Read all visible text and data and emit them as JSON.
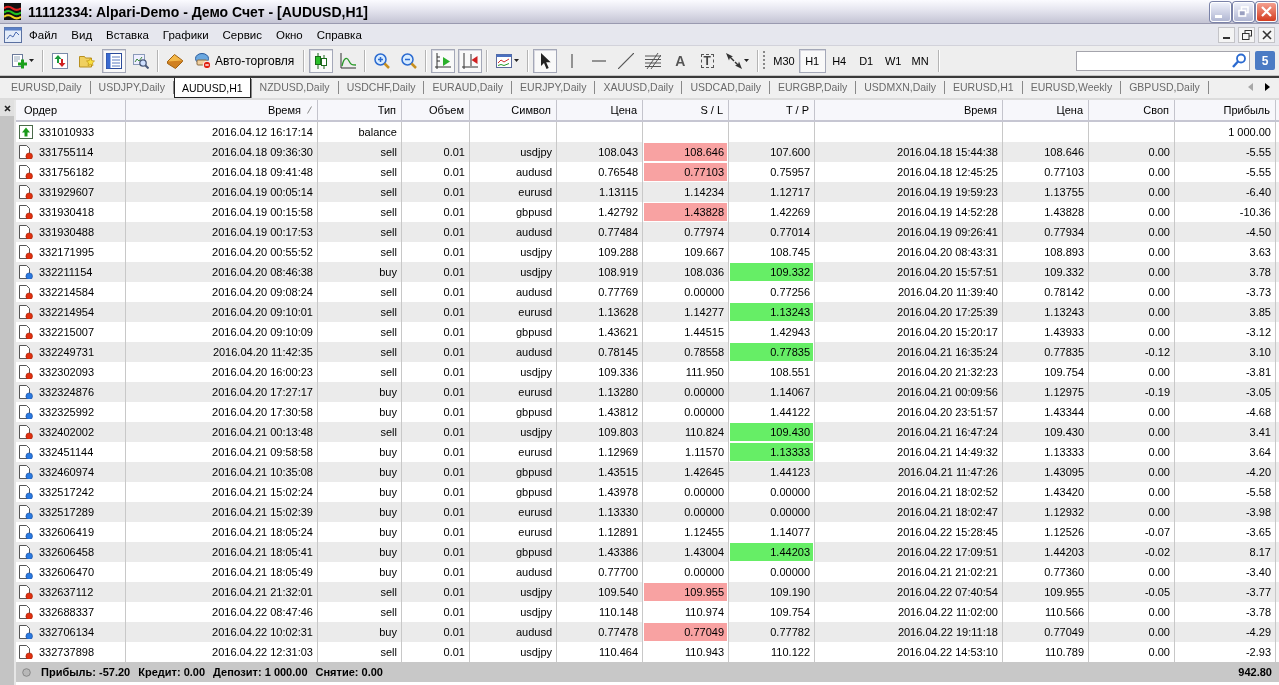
{
  "window": {
    "title": "11112334: Alpari-Demo - Демо Счет - [AUDUSD,H1]"
  },
  "menu": [
    "Файл",
    "Вид",
    "Вставка",
    "Графики",
    "Сервис",
    "Окно",
    "Справка"
  ],
  "toolbar": {
    "groups": [
      [
        {
          "kind": "newchart",
          "pressed": false
        }
      ],
      [
        {
          "kind": "marketwatch",
          "pressed": false
        },
        {
          "kind": "navigator",
          "pressed": false
        },
        {
          "kind": "terminal",
          "pressed": true
        },
        {
          "kind": "tester",
          "pressed": false
        }
      ],
      [
        {
          "kind": "editor",
          "pressed": false
        },
        {
          "kind": "autotrading",
          "label": "Авто-торговля",
          "pressed": false
        }
      ],
      [
        {
          "kind": "candles",
          "pressed": true
        },
        {
          "kind": "linechart",
          "pressed": false
        }
      ],
      [
        {
          "kind": "zoomin",
          "pressed": false
        },
        {
          "kind": "zoomout",
          "pressed": false
        }
      ],
      [
        {
          "kind": "autoscroll",
          "pressed": true
        },
        {
          "kind": "shift",
          "pressed": true
        }
      ],
      [
        {
          "kind": "indicators",
          "pressed": false
        }
      ],
      [
        {
          "kind": "cursor",
          "pressed": true
        },
        {
          "kind": "vline",
          "pressed": false
        },
        {
          "kind": "hline",
          "pressed": false
        },
        {
          "kind": "trendline",
          "pressed": false
        },
        {
          "kind": "fibo",
          "pressed": false
        },
        {
          "kind": "text",
          "label": "A",
          "pressed": false
        },
        {
          "kind": "label",
          "label": "T",
          "pressed": false
        },
        {
          "kind": "arrows",
          "pressed": false
        }
      ]
    ],
    "timeframes": [
      {
        "label": "M30",
        "selected": false
      },
      {
        "label": "H1",
        "selected": true
      },
      {
        "label": "H4",
        "selected": false
      },
      {
        "label": "D1",
        "selected": false
      },
      {
        "label": "W1",
        "selected": false
      },
      {
        "label": "MN",
        "selected": false
      }
    ],
    "notifications": "5"
  },
  "chart_tabs": {
    "tabs": [
      {
        "label": "EURUSD,Daily",
        "selected": false
      },
      {
        "label": "USDJPY,Daily",
        "selected": false
      },
      {
        "label": "AUDUSD,H1",
        "selected": true
      },
      {
        "label": "NZDUSD,Daily",
        "selected": false
      },
      {
        "label": "USDCHF,Daily",
        "selected": false
      },
      {
        "label": "EURAUD,Daily",
        "selected": false
      },
      {
        "label": "EURJPY,Daily",
        "selected": false
      },
      {
        "label": "XAUUSD,Daily",
        "selected": false
      },
      {
        "label": "USDCAD,Daily",
        "selected": false
      },
      {
        "label": "EURGBP,Daily",
        "selected": false
      },
      {
        "label": "USDMXN,Daily",
        "selected": false
      },
      {
        "label": "EURUSD,H1",
        "selected": false
      },
      {
        "label": "EURUSD,Weekly",
        "selected": false
      },
      {
        "label": "GBPUSD,Daily",
        "selected": false
      }
    ],
    "scroll_left_enabled": false,
    "scroll_right_enabled": true
  },
  "table": {
    "columns": [
      {
        "label": "Ордер",
        "sorted": false
      },
      {
        "label": "Время",
        "sorted": true
      },
      {
        "label": "Тип",
        "sorted": false
      },
      {
        "label": "Объем",
        "sorted": false
      },
      {
        "label": "Символ",
        "sorted": false
      },
      {
        "label": "Цена",
        "sorted": false
      },
      {
        "label": "S / L",
        "sorted": false
      },
      {
        "label": "T / P",
        "sorted": false
      },
      {
        "label": "Время",
        "sorted": false
      },
      {
        "label": "Цена",
        "sorted": false
      },
      {
        "label": "Своп",
        "sorted": false
      },
      {
        "label": "Прибыль",
        "sorted": false
      }
    ],
    "rows": [
      {
        "kind": "balance",
        "order": "331010933",
        "open_time": "2016.04.12 16:17:14",
        "type": "balance",
        "sl_hit": false,
        "tp_hit": false,
        "profit": "1 000.00"
      },
      {
        "kind": "sell",
        "order": "331755114",
        "open_time": "2016.04.18 09:36:30",
        "type": "sell",
        "volume": "0.01",
        "symbol": "usdjpy",
        "price": "108.043",
        "sl": "108.646",
        "sl_hit": true,
        "tp": "107.600",
        "tp_hit": false,
        "close_time": "2016.04.18 15:44:38",
        "close_price": "108.646",
        "swap": "0.00",
        "profit": "-5.55"
      },
      {
        "kind": "sell",
        "order": "331756182",
        "open_time": "2016.04.18 09:41:48",
        "type": "sell",
        "volume": "0.01",
        "symbol": "audusd",
        "price": "0.76548",
        "sl": "0.77103",
        "sl_hit": true,
        "tp": "0.75957",
        "tp_hit": false,
        "close_time": "2016.04.18 12:45:25",
        "close_price": "0.77103",
        "swap": "0.00",
        "profit": "-5.55"
      },
      {
        "kind": "sell",
        "order": "331929607",
        "open_time": "2016.04.19 00:05:14",
        "type": "sell",
        "volume": "0.01",
        "symbol": "eurusd",
        "price": "1.13115",
        "sl": "1.14234",
        "sl_hit": false,
        "tp": "1.12717",
        "tp_hit": false,
        "close_time": "2016.04.19 19:59:23",
        "close_price": "1.13755",
        "swap": "0.00",
        "profit": "-6.40"
      },
      {
        "kind": "sell",
        "order": "331930418",
        "open_time": "2016.04.19 00:15:58",
        "type": "sell",
        "volume": "0.01",
        "symbol": "gbpusd",
        "price": "1.42792",
        "sl": "1.43828",
        "sl_hit": true,
        "tp": "1.42269",
        "tp_hit": false,
        "close_time": "2016.04.19 14:52:28",
        "close_price": "1.43828",
        "swap": "0.00",
        "profit": "-10.36"
      },
      {
        "kind": "sell",
        "order": "331930488",
        "open_time": "2016.04.19 00:17:53",
        "type": "sell",
        "volume": "0.01",
        "symbol": "audusd",
        "price": "0.77484",
        "sl": "0.77974",
        "sl_hit": false,
        "tp": "0.77014",
        "tp_hit": false,
        "close_time": "2016.04.19 09:26:41",
        "close_price": "0.77934",
        "swap": "0.00",
        "profit": "-4.50"
      },
      {
        "kind": "sell",
        "order": "332171995",
        "open_time": "2016.04.20 00:55:52",
        "type": "sell",
        "volume": "0.01",
        "symbol": "usdjpy",
        "price": "109.288",
        "sl": "109.667",
        "sl_hit": false,
        "tp": "108.745",
        "tp_hit": false,
        "close_time": "2016.04.20 08:43:31",
        "close_price": "108.893",
        "swap": "0.00",
        "profit": "3.63"
      },
      {
        "kind": "buy",
        "order": "332211154",
        "open_time": "2016.04.20 08:46:38",
        "type": "buy",
        "volume": "0.01",
        "symbol": "usdjpy",
        "price": "108.919",
        "sl": "108.036",
        "sl_hit": false,
        "tp": "109.332",
        "tp_hit": true,
        "close_time": "2016.04.20 15:57:51",
        "close_price": "109.332",
        "swap": "0.00",
        "profit": "3.78"
      },
      {
        "kind": "sell",
        "order": "332214584",
        "open_time": "2016.04.20 09:08:24",
        "type": "sell",
        "volume": "0.01",
        "symbol": "audusd",
        "price": "0.77769",
        "sl": "0.00000",
        "sl_hit": false,
        "tp": "0.77256",
        "tp_hit": false,
        "close_time": "2016.04.20 11:39:40",
        "close_price": "0.78142",
        "swap": "0.00",
        "profit": "-3.73"
      },
      {
        "kind": "sell",
        "order": "332214954",
        "open_time": "2016.04.20 09:10:01",
        "type": "sell",
        "volume": "0.01",
        "symbol": "eurusd",
        "price": "1.13628",
        "sl": "1.14277",
        "sl_hit": false,
        "tp": "1.13243",
        "tp_hit": true,
        "close_time": "2016.04.20 17:25:39",
        "close_price": "1.13243",
        "swap": "0.00",
        "profit": "3.85"
      },
      {
        "kind": "sell",
        "order": "332215007",
        "open_time": "2016.04.20 09:10:09",
        "type": "sell",
        "volume": "0.01",
        "symbol": "gbpusd",
        "price": "1.43621",
        "sl": "1.44515",
        "sl_hit": false,
        "tp": "1.42943",
        "tp_hit": false,
        "close_time": "2016.04.20 15:20:17",
        "close_price": "1.43933",
        "swap": "0.00",
        "profit": "-3.12"
      },
      {
        "kind": "sell",
        "order": "332249731",
        "open_time": "2016.04.20 11:42:35",
        "type": "sell",
        "volume": "0.01",
        "symbol": "audusd",
        "price": "0.78145",
        "sl": "0.78558",
        "sl_hit": false,
        "tp": "0.77835",
        "tp_hit": true,
        "close_time": "2016.04.21 16:35:24",
        "close_price": "0.77835",
        "swap": "-0.12",
        "profit": "3.10"
      },
      {
        "kind": "sell",
        "order": "332302093",
        "open_time": "2016.04.20 16:00:23",
        "type": "sell",
        "volume": "0.01",
        "symbol": "usdjpy",
        "price": "109.336",
        "sl": "111.950",
        "sl_hit": false,
        "tp": "108.551",
        "tp_hit": false,
        "close_time": "2016.04.20 21:32:23",
        "close_price": "109.754",
        "swap": "0.00",
        "profit": "-3.81"
      },
      {
        "kind": "buy",
        "order": "332324876",
        "open_time": "2016.04.20 17:27:17",
        "type": "buy",
        "volume": "0.01",
        "symbol": "eurusd",
        "price": "1.13280",
        "sl": "0.00000",
        "sl_hit": false,
        "tp": "1.14067",
        "tp_hit": false,
        "close_time": "2016.04.21 00:09:56",
        "close_price": "1.12975",
        "swap": "-0.19",
        "profit": "-3.05"
      },
      {
        "kind": "buy",
        "order": "332325992",
        "open_time": "2016.04.20 17:30:58",
        "type": "buy",
        "volume": "0.01",
        "symbol": "gbpusd",
        "price": "1.43812",
        "sl": "0.00000",
        "sl_hit": false,
        "tp": "1.44122",
        "tp_hit": false,
        "close_time": "2016.04.20 23:51:57",
        "close_price": "1.43344",
        "swap": "0.00",
        "profit": "-4.68"
      },
      {
        "kind": "sell",
        "order": "332402002",
        "open_time": "2016.04.21 00:13:48",
        "type": "sell",
        "volume": "0.01",
        "symbol": "usdjpy",
        "price": "109.803",
        "sl": "110.824",
        "sl_hit": false,
        "tp": "109.430",
        "tp_hit": true,
        "close_time": "2016.04.21 16:47:24",
        "close_price": "109.430",
        "swap": "0.00",
        "profit": "3.41"
      },
      {
        "kind": "buy",
        "order": "332451144",
        "open_time": "2016.04.21 09:58:58",
        "type": "buy",
        "volume": "0.01",
        "symbol": "eurusd",
        "price": "1.12969",
        "sl": "1.11570",
        "sl_hit": false,
        "tp": "1.13333",
        "tp_hit": true,
        "close_time": "2016.04.21 14:49:32",
        "close_price": "1.13333",
        "swap": "0.00",
        "profit": "3.64"
      },
      {
        "kind": "buy",
        "order": "332460974",
        "open_time": "2016.04.21 10:35:08",
        "type": "buy",
        "volume": "0.01",
        "symbol": "gbpusd",
        "price": "1.43515",
        "sl": "1.42645",
        "sl_hit": false,
        "tp": "1.44123",
        "tp_hit": false,
        "close_time": "2016.04.21 11:47:26",
        "close_price": "1.43095",
        "swap": "0.00",
        "profit": "-4.20"
      },
      {
        "kind": "buy",
        "order": "332517242",
        "open_time": "2016.04.21 15:02:24",
        "type": "buy",
        "volume": "0.01",
        "symbol": "gbpusd",
        "price": "1.43978",
        "sl": "0.00000",
        "sl_hit": false,
        "tp": "0.00000",
        "tp_hit": false,
        "close_time": "2016.04.21 18:02:52",
        "close_price": "1.43420",
        "swap": "0.00",
        "profit": "-5.58"
      },
      {
        "kind": "buy",
        "order": "332517289",
        "open_time": "2016.04.21 15:02:39",
        "type": "buy",
        "volume": "0.01",
        "symbol": "eurusd",
        "price": "1.13330",
        "sl": "0.00000",
        "sl_hit": false,
        "tp": "0.00000",
        "tp_hit": false,
        "close_time": "2016.04.21 18:02:47",
        "close_price": "1.12932",
        "swap": "0.00",
        "profit": "-3.98"
      },
      {
        "kind": "buy",
        "order": "332606419",
        "open_time": "2016.04.21 18:05:24",
        "type": "buy",
        "volume": "0.01",
        "symbol": "eurusd",
        "price": "1.12891",
        "sl": "1.12455",
        "sl_hit": false,
        "tp": "1.14077",
        "tp_hit": false,
        "close_time": "2016.04.22 15:28:45",
        "close_price": "1.12526",
        "swap": "-0.07",
        "profit": "-3.65"
      },
      {
        "kind": "buy",
        "order": "332606458",
        "open_time": "2016.04.21 18:05:41",
        "type": "buy",
        "volume": "0.01",
        "symbol": "gbpusd",
        "price": "1.43386",
        "sl": "1.43004",
        "sl_hit": false,
        "tp": "1.44203",
        "tp_hit": true,
        "close_time": "2016.04.22 17:09:51",
        "close_price": "1.44203",
        "swap": "-0.02",
        "profit": "8.17"
      },
      {
        "kind": "buy",
        "order": "332606470",
        "open_time": "2016.04.21 18:05:49",
        "type": "buy",
        "volume": "0.01",
        "symbol": "audusd",
        "price": "0.77700",
        "sl": "0.00000",
        "sl_hit": false,
        "tp": "0.00000",
        "tp_hit": false,
        "close_time": "2016.04.21 21:02:21",
        "close_price": "0.77360",
        "swap": "0.00",
        "profit": "-3.40"
      },
      {
        "kind": "sell",
        "order": "332637112",
        "open_time": "2016.04.21 21:32:01",
        "type": "sell",
        "volume": "0.01",
        "symbol": "usdjpy",
        "price": "109.540",
        "sl": "109.955",
        "sl_hit": true,
        "tp": "109.190",
        "tp_hit": false,
        "close_time": "2016.04.22 07:40:54",
        "close_price": "109.955",
        "swap": "-0.05",
        "profit": "-3.77"
      },
      {
        "kind": "sell",
        "order": "332688337",
        "open_time": "2016.04.22 08:47:46",
        "type": "sell",
        "volume": "0.01",
        "symbol": "usdjpy",
        "price": "110.148",
        "sl": "110.974",
        "sl_hit": false,
        "tp": "109.754",
        "tp_hit": false,
        "close_time": "2016.04.22 11:02:00",
        "close_price": "110.566",
        "swap": "0.00",
        "profit": "-3.78"
      },
      {
        "kind": "buy",
        "order": "332706134",
        "open_time": "2016.04.22 10:02:31",
        "type": "buy",
        "volume": "0.01",
        "symbol": "audusd",
        "price": "0.77478",
        "sl": "0.77049",
        "sl_hit": true,
        "tp": "0.77782",
        "tp_hit": false,
        "close_time": "2016.04.22 19:11:18",
        "close_price": "0.77049",
        "swap": "0.00",
        "profit": "-4.29"
      },
      {
        "kind": "sell",
        "order": "332737898",
        "open_time": "2016.04.22 12:31:03",
        "type": "sell",
        "volume": "0.01",
        "symbol": "usdjpy",
        "price": "110.464",
        "sl": "110.943",
        "sl_hit": false,
        "tp": "110.122",
        "tp_hit": false,
        "close_time": "2016.04.22 14:53:10",
        "close_price": "110.789",
        "swap": "0.00",
        "profit": "-2.93"
      }
    ]
  },
  "status_bar": {
    "summary": [
      "Прибыль: -57.20",
      "Кредит: 0.00",
      "Депозит: 1 000.00",
      "Снятие: 0.00"
    ],
    "total": "942.80"
  }
}
